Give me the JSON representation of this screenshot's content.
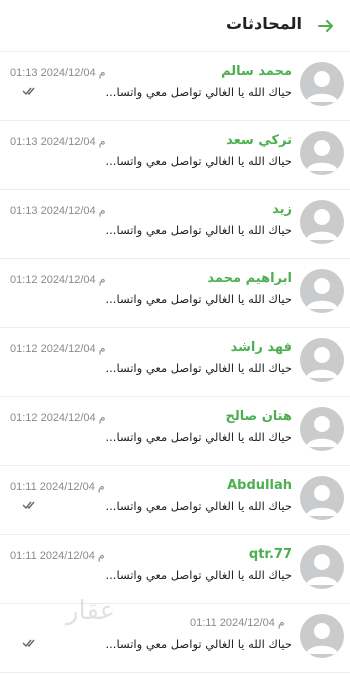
{
  "header": {
    "title": "المحادثات",
    "back_icon": "arrow-right-icon",
    "accent": "#4caf50"
  },
  "conversations": [
    {
      "name": "محمد سالم",
      "preview": "حياك الله يا الغالي تواصل معي واتسا...",
      "time": "01:13 2024/12/04 م",
      "read_ticks": true
    },
    {
      "name": "تركي سعد",
      "preview": "حياك الله يا الغالي تواصل معي واتسا...",
      "time": "01:13 2024/12/04 م",
      "read_ticks": false
    },
    {
      "name": "زيد",
      "preview": "حياك الله يا الغالي تواصل معي واتسا...",
      "time": "01:13 2024/12/04 م",
      "read_ticks": false
    },
    {
      "name": "ابراهيم محمد",
      "preview": "حياك الله يا الغالي تواصل معي واتسا...",
      "time": "01:12 2024/12/04 م",
      "read_ticks": false
    },
    {
      "name": "فهد راشد",
      "preview": "حياك الله يا الغالي تواصل معي واتسا...",
      "time": "01:12 2024/12/04 م",
      "read_ticks": false
    },
    {
      "name": "هتان صالح",
      "preview": "حياك الله يا الغالي تواصل معي واتسا...",
      "time": "01:12 2024/12/04 م",
      "read_ticks": false
    },
    {
      "name": "Abdullah",
      "preview": "حياك الله يا الغالي تواصل معي واتسا...",
      "time": "01:11 2024/12/04 م",
      "read_ticks": true
    },
    {
      "name": "qtr.77",
      "preview": "حياك الله يا الغالي تواصل معي واتسا...",
      "time": "01:11 2024/12/04 م",
      "read_ticks": false
    },
    {
      "name": "",
      "preview": "حياك الله يا الغالي تواصل معي واتسا...",
      "time": "01:11 2024/12/04 م",
      "read_ticks": true
    }
  ],
  "watermark": "عقار"
}
